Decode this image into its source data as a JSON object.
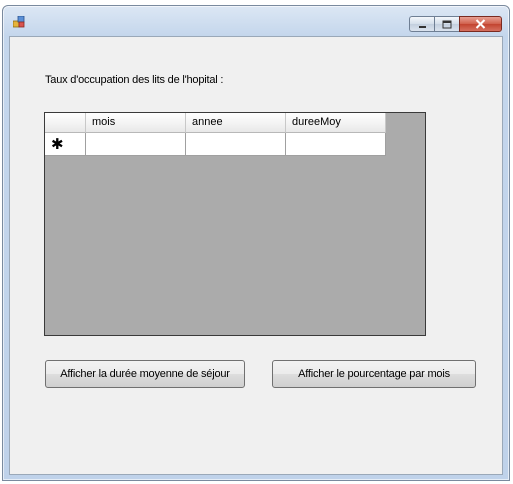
{
  "window": {
    "title": ""
  },
  "form": {
    "label": "Taux d'occupation des lits de l'hopital :"
  },
  "grid": {
    "columns": [
      "mois",
      "annee",
      "dureeMoy"
    ],
    "new_row_marker": "✱"
  },
  "buttons": {
    "duree": "Afficher la durée moyenne de séjour",
    "pourcentage": "Afficher le pourcentage par mois"
  }
}
